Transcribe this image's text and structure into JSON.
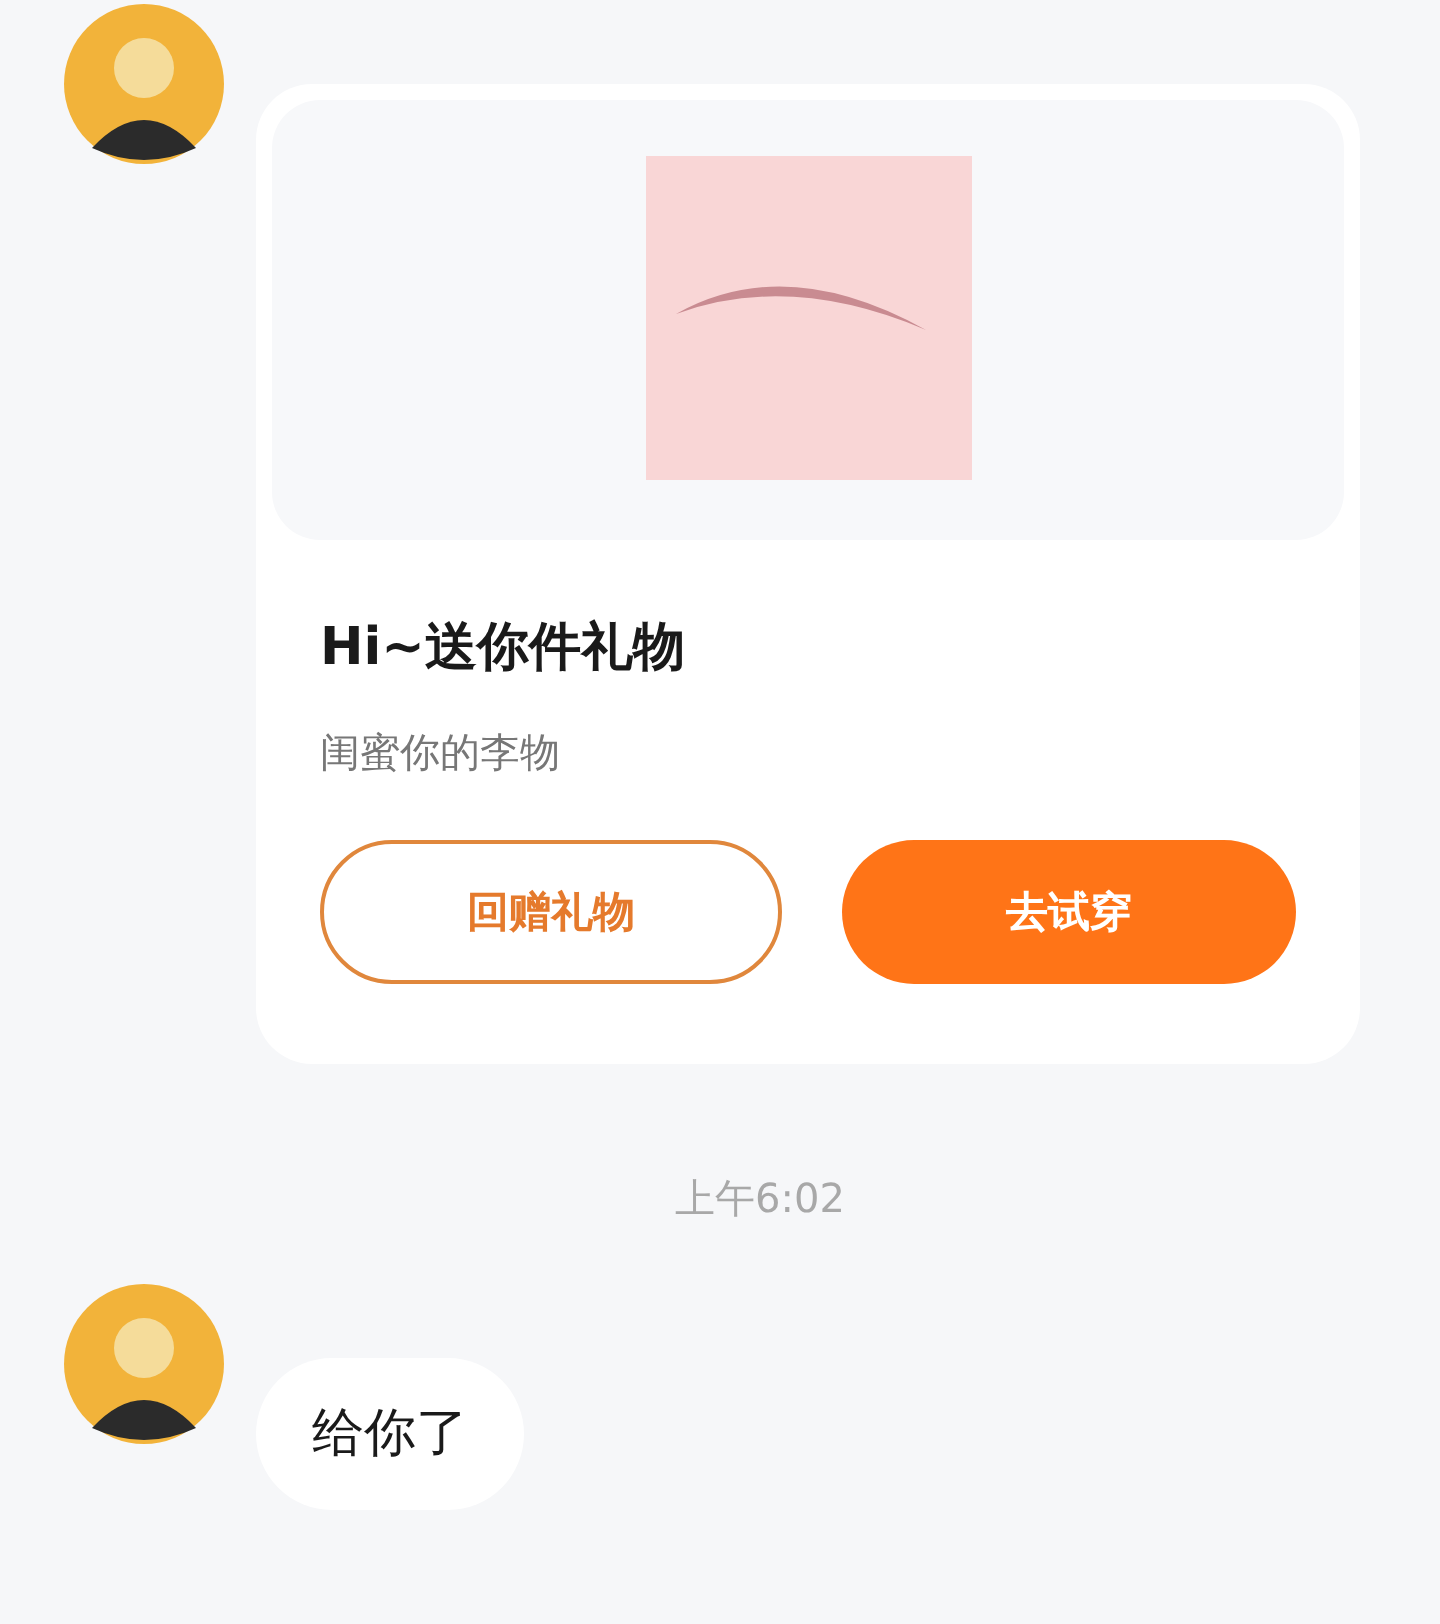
{
  "messages": [
    {
      "kind": "gift_card",
      "card": {
        "title": "Hi~送你件礼物",
        "subtitle": "闺蜜你的李物",
        "buttons": [
          {
            "label": "回赠礼物",
            "kind": "outline"
          },
          {
            "label": "去试穿",
            "kind": "filled"
          }
        ]
      }
    },
    {
      "kind": "timestamp",
      "text": "上午6:02"
    },
    {
      "kind": "text",
      "text": "给你了"
    }
  ]
}
